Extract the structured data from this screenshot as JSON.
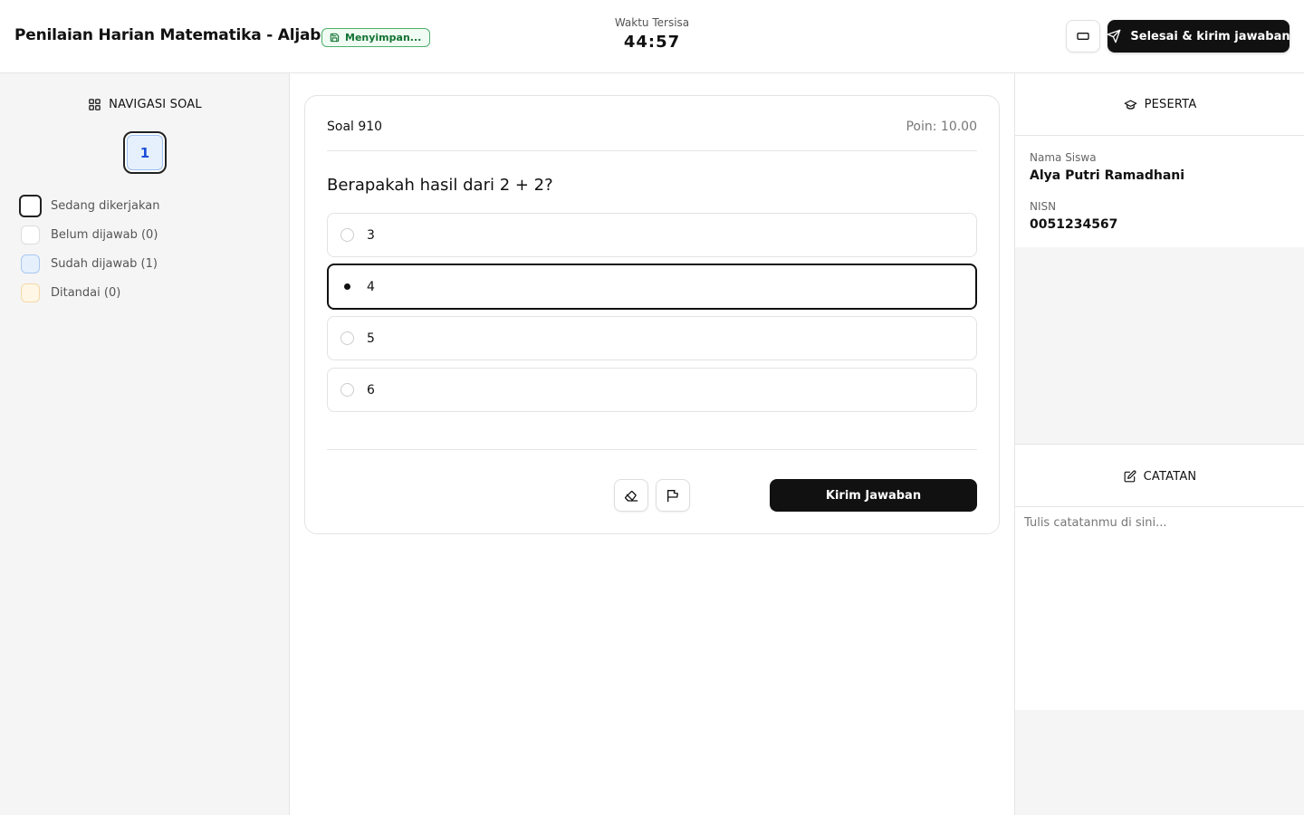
{
  "header": {
    "title": "Penilaian Harian Matematika - Aljabar",
    "saving_status": "Menyimpan...",
    "timer_label": "Waktu Tersisa",
    "timer_value": "44:57",
    "finish_label": "Selesai & kirim jawaban"
  },
  "navigation": {
    "heading": "NAVIGASI SOAL",
    "questions": [
      "1"
    ],
    "legend": {
      "current": "Sedang dikerjakan",
      "unanswered": "Belum dijawab (0)",
      "answered": "Sudah dijawab (1)",
      "flagged": "Ditandai (0)"
    }
  },
  "question": {
    "number_label": "Soal 910",
    "points_label": "Poin: 10.00",
    "text": "Berapakah hasil dari 2 + 2?",
    "options": [
      "3",
      "4",
      "5",
      "6"
    ],
    "selected": "4",
    "submit_label": "Kirim Jawaban"
  },
  "participant": {
    "heading": "PESERTA",
    "name_label": "Nama Siswa",
    "name": "Alya Putri Ramadhani",
    "nisn_label": "NISN",
    "nisn": "0051234567"
  },
  "notes": {
    "heading": "CATATAN",
    "placeholder": "Tulis catatanmu di sini..."
  },
  "colors": {
    "primary": "#111111",
    "saving": "#137333",
    "answered": "#e6f0fc",
    "flagged": "#fff6e5"
  }
}
